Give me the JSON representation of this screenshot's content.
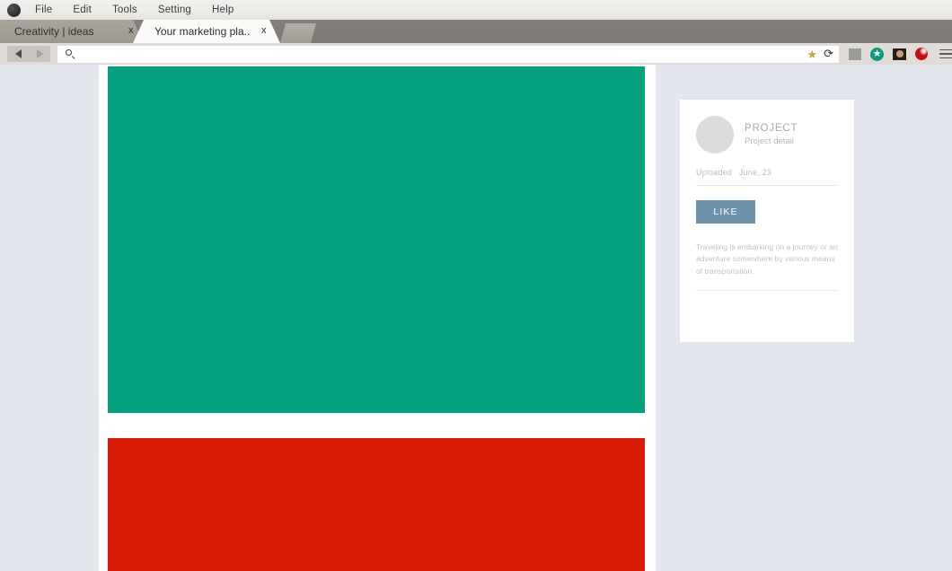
{
  "browser": {
    "menu": {
      "logo_icon": "circle-logo-icon",
      "items": [
        {
          "label": "File"
        },
        {
          "label": "Edit"
        },
        {
          "label": "Tools"
        },
        {
          "label": "Setting"
        },
        {
          "label": "Help"
        }
      ]
    },
    "tabs": [
      {
        "label": "Creativity  |  ideas",
        "close_label": "x",
        "active": false
      },
      {
        "label": "Your marketing pla..",
        "close_label": "x",
        "active": true
      }
    ],
    "new_tab_label": "",
    "toolbar": {
      "back_icon": "back-arrow-icon",
      "forward_icon": "forward-arrow-icon",
      "search_icon": "search-icon",
      "url_value": "",
      "url_placeholder": "",
      "bookmark_icon": "star-icon",
      "bookmark_glyph": "★",
      "reload_icon": "reload-icon",
      "reload_glyph": "⟳",
      "extensions": [
        {
          "name": "gray-square-extension-icon",
          "glyph": ""
        },
        {
          "name": "teal-star-extension-icon",
          "glyph": "★"
        },
        {
          "name": "camera-extension-icon",
          "glyph": ""
        },
        {
          "name": "red-dot-extension-icon",
          "glyph": ""
        }
      ],
      "menu_icon": "hamburger-menu-icon"
    }
  },
  "page": {
    "background_color": "#e3e6ed",
    "content_column_color": "#ffffff",
    "media_blocks": [
      {
        "name": "green-media-block",
        "color": "#05a07e"
      },
      {
        "name": "red-media-block",
        "color": "#d91a05"
      }
    ],
    "card": {
      "avatar_icon": "avatar-placeholder-icon",
      "title": "PROJECT",
      "subtitle": "Project detail",
      "uploaded_label": "Uploaded",
      "uploaded_date": "June, 23",
      "like_label": "LIKE",
      "like_color": "#6e93a8",
      "description": "Traveling is embarking on a journey or an adventure somewhere by various means of transportation."
    }
  }
}
